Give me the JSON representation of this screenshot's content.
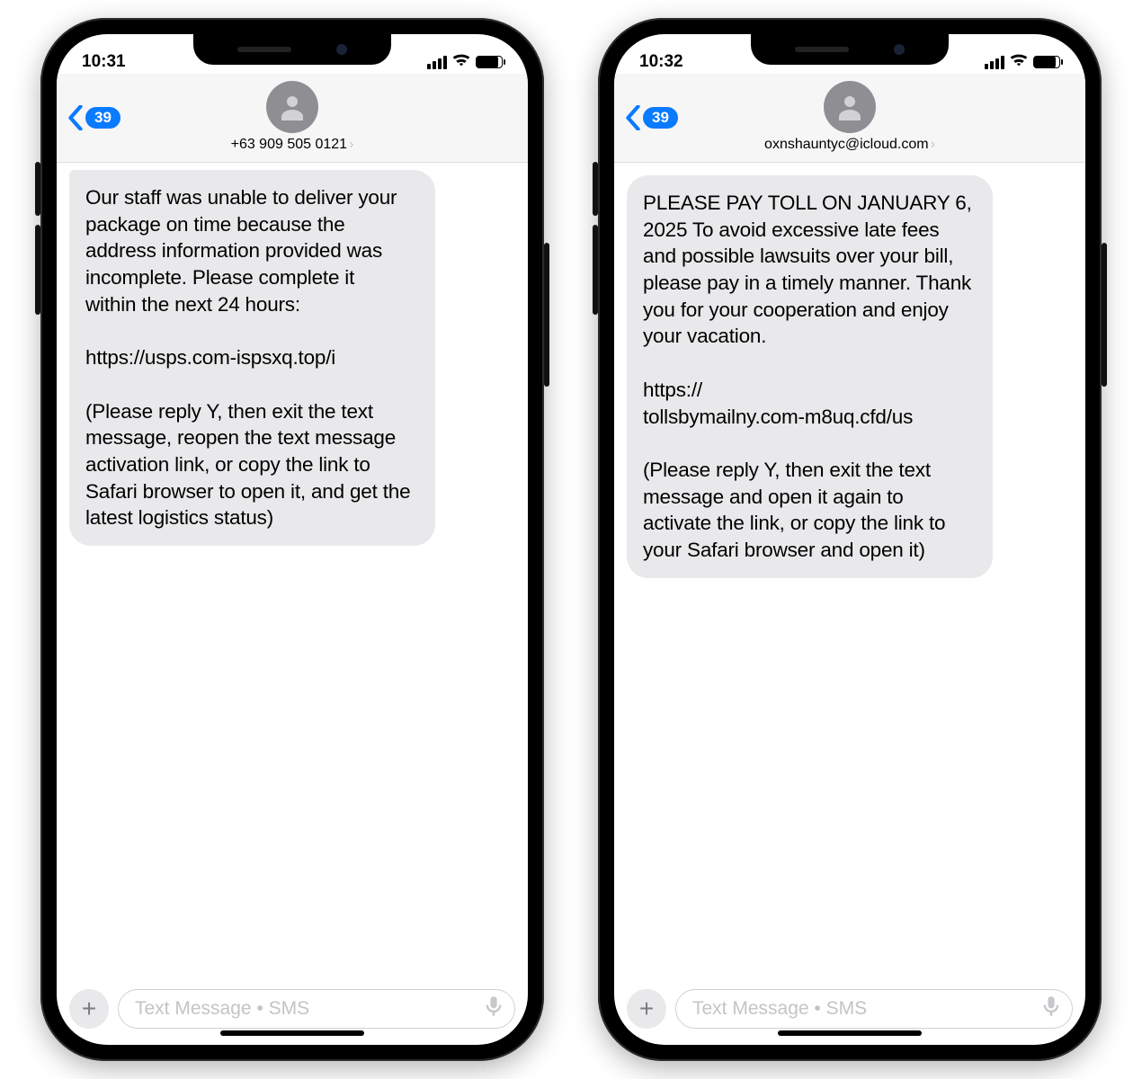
{
  "phones": [
    {
      "time": "10:31",
      "back_count": "39",
      "sender": "+63 909 505 0121",
      "message": "Our staff was unable to deliver your package on time because the address information provided was incomplete. Please complete it\nwithin the next 24 hours:\n\nhttps://usps.com-ispsxq.top/i\n\n(Please reply Y, then exit the text message, reopen the text message activation link, or copy the link to Safari browser to open it, and get the latest logistics status)",
      "input_placeholder": "Text Message • SMS"
    },
    {
      "time": "10:32",
      "back_count": "39",
      "sender": "oxnshauntyc@icloud.com",
      "message": "PLEASE PAY TOLL ON JANUARY 6, 2025 To avoid excessive late fees and possible lawsuits over your bill, please pay in a timely manner. Thank you for your cooperation and enjoy your vacation.\n\nhttps://\ntollsbymailny.com-m8uq.cfd/us\n\n(Please reply Y, then exit the text message and open it again to activate the link, or copy the link to your Safari browser and open it)",
      "input_placeholder": "Text Message • SMS"
    }
  ]
}
